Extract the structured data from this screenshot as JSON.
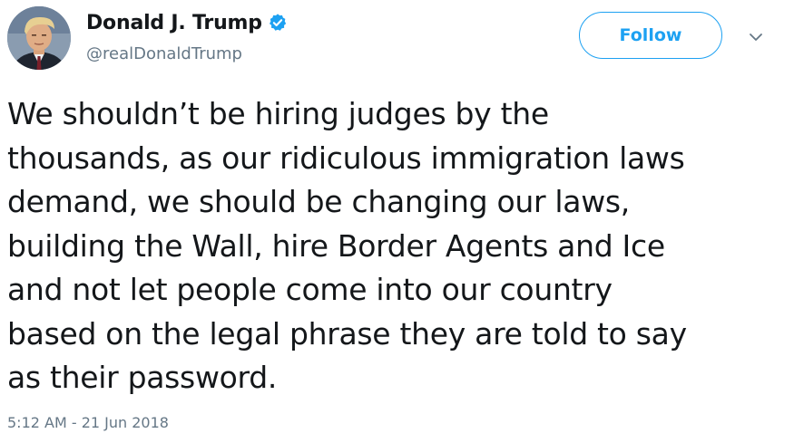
{
  "user": {
    "display_name": "Donald J. Trump",
    "handle": "@realDonaldTrump",
    "verified": true,
    "avatar_icon": "profile-photo"
  },
  "actions": {
    "follow_label": "Follow",
    "caret_icon": "chevron-down-icon"
  },
  "tweet": {
    "text": "We shouldn’t be hiring judges by the\nthousands, as our ridiculous immigration laws\ndemand, we should be changing our laws,\nbuilding the Wall, hire Border Agents and Ice\nand not let people come into our country\nbased on the legal phrase they are told to say\nas their password.",
    "timestamp": "5:12 AM - 21 Jun 2018"
  },
  "colors": {
    "accent": "#1da1f2",
    "text": "#14171a",
    "secondary_text": "#657786"
  }
}
